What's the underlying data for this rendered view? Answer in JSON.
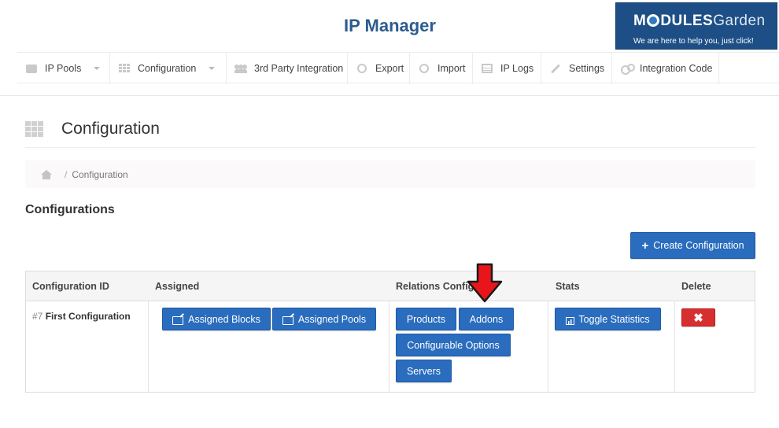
{
  "header": {
    "app_title": "IP Manager",
    "logo": {
      "name_part1": "M",
      "name_part2": "DULES",
      "name_part3": "Garden",
      "tagline": "We are here to help you, just click!"
    }
  },
  "nav": {
    "items": [
      {
        "label": "IP Pools",
        "icon": "box-icon",
        "dropdown": true
      },
      {
        "label": "Configuration",
        "icon": "grid-icon",
        "dropdown": true
      },
      {
        "label": "3rd Party Integration",
        "icon": "users-icon",
        "dropdown": false
      },
      {
        "label": "Export",
        "icon": "export-icon",
        "dropdown": false
      },
      {
        "label": "Import",
        "icon": "import-icon",
        "dropdown": false
      },
      {
        "label": "IP Logs",
        "icon": "list-icon",
        "dropdown": false
      },
      {
        "label": "Settings",
        "icon": "wrench-icon",
        "dropdown": false
      },
      {
        "label": "Integration Code",
        "icon": "gears-icon",
        "dropdown": false
      }
    ]
  },
  "page": {
    "title": "Configuration"
  },
  "breadcrumb": {
    "separator": "/",
    "current": "Configuration"
  },
  "section": {
    "title": "Configurations",
    "create_button": "Create Configuration"
  },
  "table": {
    "headers": [
      "Configuration ID",
      "Assigned",
      "Relations Config",
      "Stats",
      "Delete"
    ],
    "rows": [
      {
        "id_prefix": "#7",
        "name": "First Configuration",
        "assigned_buttons": [
          "Assigned Blocks",
          "Assigned Pools"
        ],
        "relation_buttons": [
          "Products",
          "Addons",
          "Configurable Options",
          "Servers"
        ],
        "stats_button": "Toggle Statistics",
        "delete_button": "✖"
      }
    ]
  },
  "colors": {
    "primary": "#2a6cbd",
    "danger": "#d72f2f",
    "title_blue": "#2d5c8f",
    "annotation_arrow": "#e8161b"
  }
}
